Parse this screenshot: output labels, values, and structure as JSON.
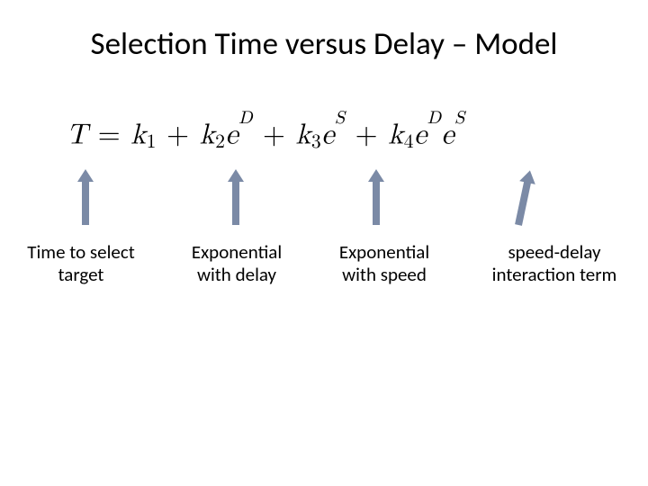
{
  "title": "Selection Time versus Delay – Model",
  "equation": {
    "lhs_var": "T",
    "eq": " = ",
    "k1": "k",
    "k1_sub": "1",
    "plus1": " + ",
    "k2": "k",
    "k2_sub": "2",
    "e2": "e",
    "e2_sup": "D",
    "plus2": " + ",
    "k3": "k",
    "k3_sub": "3",
    "e3": "e",
    "e3_sup": "S",
    "plus3": " + ",
    "k4": "k",
    "k4_sub": "4",
    "e4a": "e",
    "e4a_sup": "D",
    "e4b": "e",
    "e4b_sup": "S"
  },
  "labels": {
    "l1_line1": "Time to select",
    "l1_line2": "target",
    "l2_line1": "Exponential",
    "l2_line2": "with delay",
    "l3_line1": "Exponential",
    "l3_line2": "with speed",
    "l4_line1": "speed-delay",
    "l4_line2": "interaction term"
  },
  "colors": {
    "arrow": "#7b8aa6",
    "text": "#000000",
    "background": "#ffffff"
  }
}
